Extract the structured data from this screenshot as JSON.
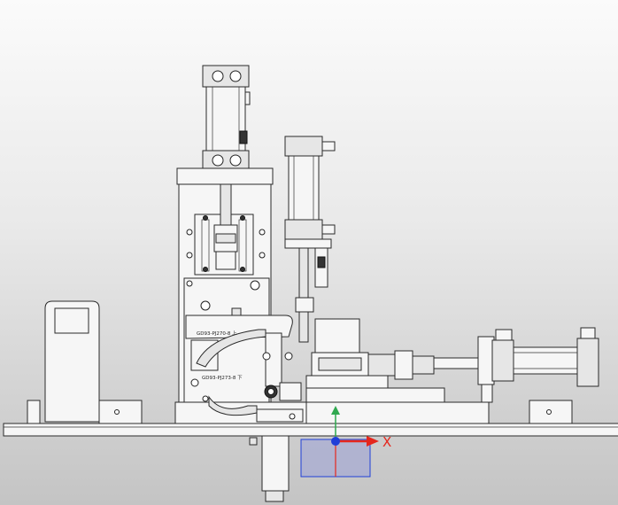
{
  "viewport": {
    "background_top": "#fbfbfb",
    "background_bottom": "#c4c4c4"
  },
  "labels": {
    "upper_part_label": "GD93-PJ270-8 上",
    "lower_part_label": "GD93-PJ273-8 下"
  },
  "triad": {
    "x_label": "X",
    "x_color": "#e5271d",
    "y_color": "#2fa84f",
    "z_color": "#1f3fd8",
    "plane_color": "#9aa0d6"
  }
}
